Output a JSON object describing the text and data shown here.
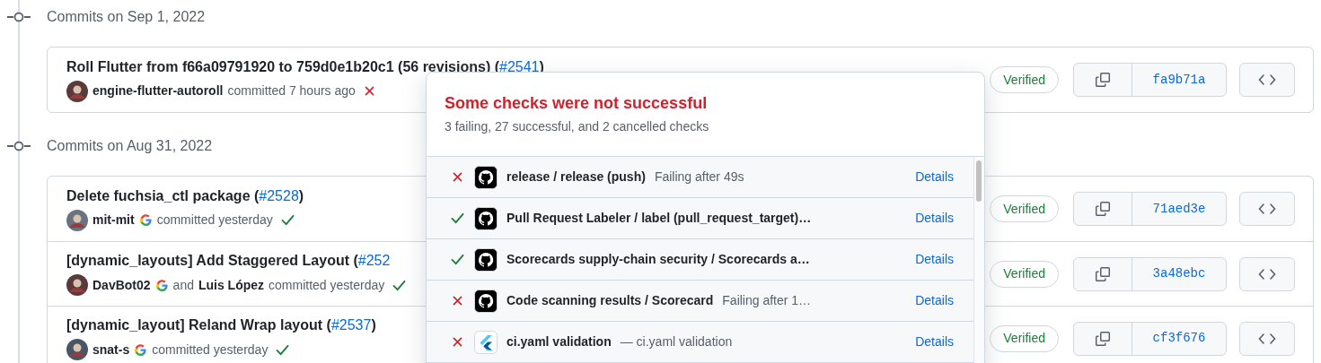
{
  "groups": [
    {
      "heading": "Commits on Sep 1, 2022",
      "commits": [
        {
          "title": "Roll Flutter from f66a09791920 to 759d0e1b20c1 (56 revisions) (",
          "pr": "#2541",
          "title_end": ")",
          "authors": [
            {
              "name": "engine-flutter-autoroll",
              "google": false
            }
          ],
          "action": "committed 7 hours ago",
          "passed": false,
          "verified": "Verified",
          "sha": "fa9b71a"
        }
      ]
    },
    {
      "heading": "Commits on Aug 31, 2022",
      "commits": [
        {
          "title": "Delete fuchsia_ctl package (",
          "pr": "#2528",
          "title_end": ")",
          "authors": [
            {
              "name": "mit-mit",
              "google": true
            }
          ],
          "action": "committed yesterday",
          "passed": true,
          "verified": "Verified",
          "sha": "71aed3e"
        },
        {
          "title": "[dynamic_layouts] Add Staggered Layout (",
          "pr": "#252",
          "authors": [
            {
              "name": "DavBot02",
              "google": true
            },
            {
              "name": "Luis López",
              "google": false
            }
          ],
          "joiner": "and",
          "action": "committed yesterday",
          "passed": true,
          "verified": "Verified",
          "sha": "3a48ebc"
        },
        {
          "title": "[dynamic_layout] Reland Wrap layout (",
          "pr": "#2537",
          "title_end": ")",
          "authors": [
            {
              "name": "snat-s",
              "google": true
            }
          ],
          "action": "committed yesterday",
          "passed": true,
          "verified": "Verified",
          "sha": "cf3f676"
        }
      ]
    }
  ],
  "popup": {
    "title": "Some checks were not successful",
    "summary": "3 failing, 27 successful, and 2 cancelled checks",
    "checks": [
      {
        "passed": false,
        "kind": "github",
        "name": "release / release (push)",
        "detail": "Failing after 49s",
        "link": "Details"
      },
      {
        "passed": true,
        "kind": "github",
        "name": "Pull Request Labeler / label (pull_request_target)…",
        "link": "Details"
      },
      {
        "passed": true,
        "kind": "github",
        "name": "Scorecards supply-chain security / Scorecards a…",
        "link": "Details"
      },
      {
        "passed": false,
        "kind": "github",
        "name": "Code scanning results / Scorecard",
        "detail": "Failing after 1…",
        "link": "Details"
      },
      {
        "passed": false,
        "kind": "flutter",
        "name": "ci.yaml validation",
        "detail": "— ci.yaml validation",
        "link": "Details"
      }
    ]
  }
}
